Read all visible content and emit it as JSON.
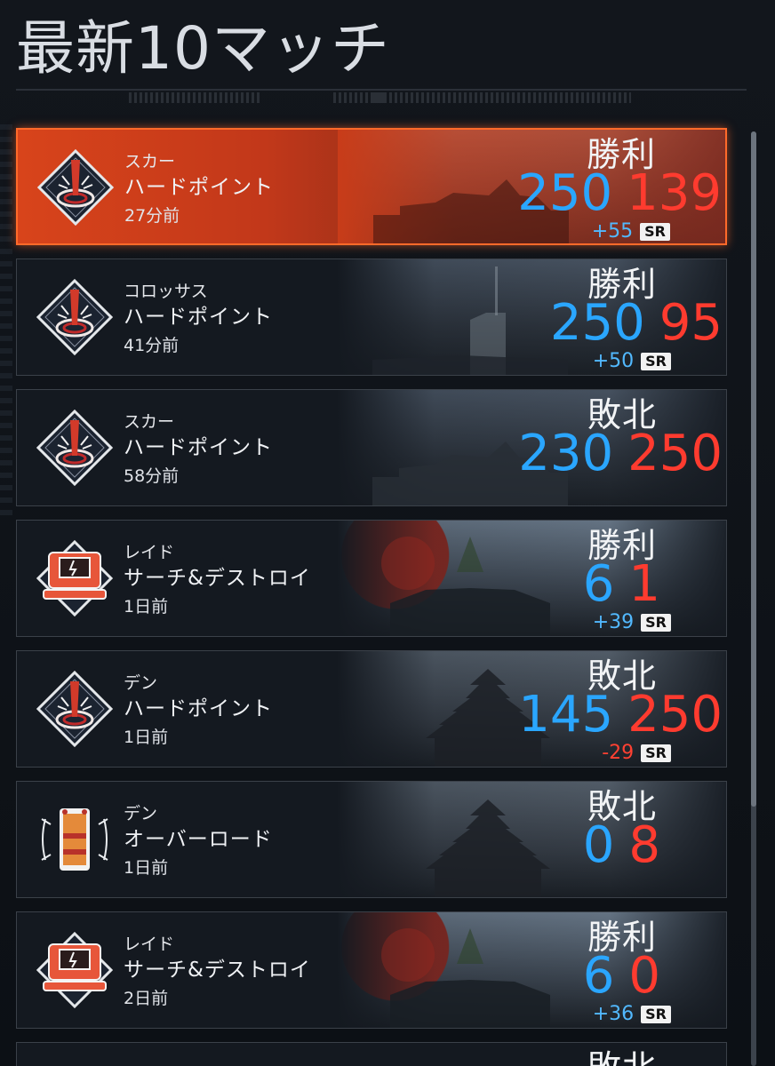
{
  "header": {
    "title": "最新10マッチ"
  },
  "sr_badge": "SR",
  "colors": {
    "team_blue": "#2aa6ff",
    "team_red": "#ff3b2f",
    "highlight": "#ff6a2a"
  },
  "matches": [
    {
      "map": "スカー",
      "mode": "ハードポイント",
      "time": "27分前",
      "result": "勝利",
      "score_blue": "250",
      "score_red": "139",
      "sr_delta": "+55",
      "emblem": "hardpoint-emblem-icon"
    },
    {
      "map": "コロッサス",
      "mode": "ハードポイント",
      "time": "41分前",
      "result": "勝利",
      "score_blue": "250",
      "score_red": "95",
      "sr_delta": "+50",
      "emblem": "hardpoint-emblem-icon"
    },
    {
      "map": "スカー",
      "mode": "ハードポイント",
      "time": "58分前",
      "result": "敗北",
      "score_blue": "230",
      "score_red": "250",
      "sr_delta": "",
      "emblem": "hardpoint-emblem-icon"
    },
    {
      "map": "レイド",
      "mode": "サーチ&デストロイ",
      "time": "1日前",
      "result": "勝利",
      "score_blue": "6",
      "score_red": "1",
      "sr_delta": "+39",
      "emblem": "search-destroy-emblem-icon"
    },
    {
      "map": "デン",
      "mode": "ハードポイント",
      "time": "1日前",
      "result": "敗北",
      "score_blue": "145",
      "score_red": "250",
      "sr_delta": "-29",
      "emblem": "hardpoint-emblem-icon"
    },
    {
      "map": "デン",
      "mode": "オーバーロード",
      "time": "1日前",
      "result": "敗北",
      "score_blue": "0",
      "score_red": "8",
      "sr_delta": "",
      "emblem": "overload-emblem-icon"
    },
    {
      "map": "レイド",
      "mode": "サーチ&デストロイ",
      "time": "2日前",
      "result": "勝利",
      "score_blue": "6",
      "score_red": "0",
      "sr_delta": "+36",
      "emblem": "search-destroy-emblem-icon"
    }
  ],
  "partial_row": {
    "result": "敗北"
  }
}
